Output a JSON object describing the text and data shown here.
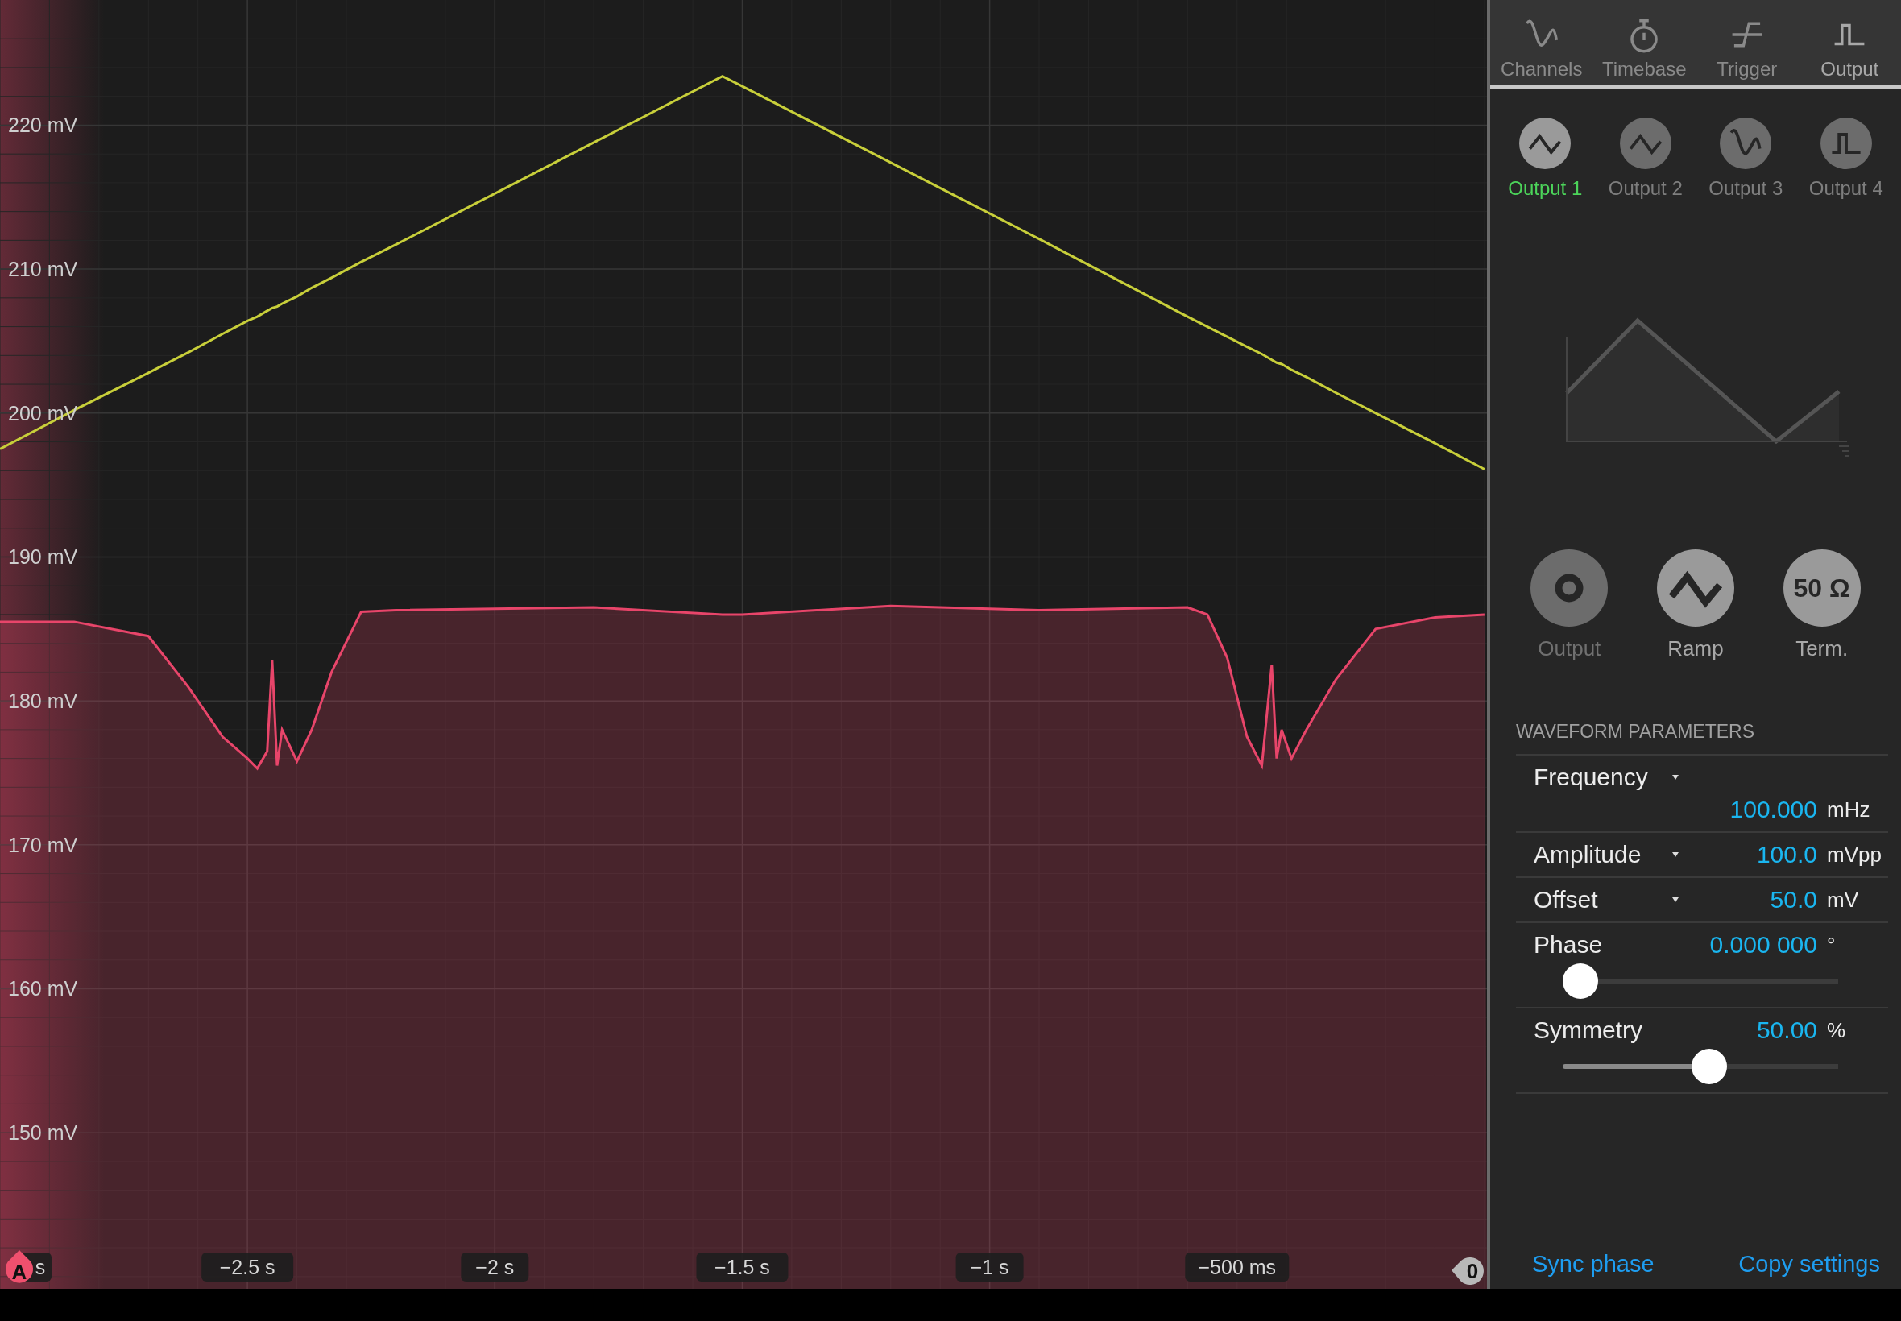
{
  "scope": {
    "chart_data": {
      "type": "line",
      "grid": true,
      "xlim": [
        -3.0,
        0.005
      ],
      "ylim": [
        139.15,
        228.7
      ],
      "yticks": [
        {
          "value": 220,
          "label": "220 mV"
        },
        {
          "value": 210,
          "label": "210 mV"
        },
        {
          "value": 200,
          "label": "200 mV"
        },
        {
          "value": 190,
          "label": "190 mV"
        },
        {
          "value": 180,
          "label": "180 mV"
        },
        {
          "value": 170,
          "label": "170 mV"
        },
        {
          "value": 160,
          "label": "160 mV"
        },
        {
          "value": 150,
          "label": "150 mV"
        }
      ],
      "xticks": [
        {
          "value": -2.5,
          "label": "−2.5 s"
        },
        {
          "value": -2.0,
          "label": "−2 s"
        },
        {
          "value": -1.5,
          "label": "−1.5 s"
        },
        {
          "value": -1.0,
          "label": "−1 s"
        }
      ],
      "x": [
        -3.0,
        -2.85,
        -2.7,
        -2.62,
        -2.55,
        -2.5,
        -2.48,
        -2.46,
        -2.45,
        -2.44,
        -2.43,
        -2.4,
        -2.37,
        -2.33,
        -2.27,
        -2.2,
        -1.8,
        -1.54,
        -1.5,
        -1.2,
        -0.9,
        -0.6,
        -0.56,
        -0.52,
        -0.48,
        -0.45,
        -0.43,
        -0.42,
        -0.41,
        -0.39,
        -0.36,
        -0.3,
        -0.22,
        -0.1,
        0.0
      ],
      "series": [
        {
          "color": "#c8cf3a",
          "values": [
            197.5,
            200.2,
            202.8,
            204.2,
            205.5,
            206.4,
            206.7,
            207.1,
            207.3,
            207.4,
            207.6,
            208.1,
            208.7,
            209.4,
            210.5,
            211.7,
            218.8,
            223.4,
            222.7,
            217.4,
            212.1,
            206.7,
            206.0,
            205.3,
            204.6,
            204.1,
            203.7,
            203.5,
            203.4,
            203.0,
            202.5,
            201.4,
            200.0,
            197.9,
            196.1
          ]
        },
        {
          "color": "#e8456a",
          "values": [
            185.5,
            185.5,
            184.5,
            181.0,
            177.5,
            176.0,
            175.3,
            176.5,
            182.8,
            175.5,
            178.0,
            175.8,
            178.0,
            182.0,
            186.2,
            186.3,
            186.5,
            186.0,
            186.0,
            186.6,
            186.3,
            186.5,
            186.0,
            183.0,
            177.5,
            175.5,
            182.5,
            176.0,
            178.0,
            176.0,
            178.0,
            181.5,
            185.0,
            185.8,
            186.0
          ]
        }
      ]
    },
    "left_time_label": "s",
    "ms_time_label": "−500 ms",
    "channel_marker": {
      "label": "A"
    },
    "zero_marker": {
      "label": "0"
    }
  },
  "tabs": [
    {
      "label": "Channels",
      "kind": "sine",
      "selected": false
    },
    {
      "label": "Timebase",
      "kind": "stopwatch",
      "selected": false
    },
    {
      "label": "Trigger",
      "kind": "trigger",
      "selected": false
    },
    {
      "label": "Output",
      "kind": "pulse",
      "selected": true
    }
  ],
  "outputs": [
    {
      "label": "Output 1",
      "kind": "triangle",
      "selected": true
    },
    {
      "label": "Output 2",
      "kind": "triangle",
      "selected": false
    },
    {
      "label": "Output 3",
      "kind": "sine",
      "selected": false
    },
    {
      "label": "Output 4",
      "kind": "pulse",
      "selected": false
    }
  ],
  "controls": [
    {
      "label": "Output",
      "kind": "power",
      "on": false
    },
    {
      "label": "Ramp",
      "kind": "triangle",
      "on": true
    },
    {
      "label": "Term.",
      "kind": "text",
      "symbol": "50 Ω",
      "on": true
    }
  ],
  "parameters": {
    "title": "WAVEFORM PARAMETERS",
    "rows": [
      {
        "kind": "dropdown-wrapped",
        "label": "Frequency",
        "value": "100.000",
        "unit": "mHz"
      },
      {
        "kind": "dropdown",
        "label": "Amplitude",
        "value": "100.0",
        "unit": "mVpp"
      },
      {
        "kind": "dropdown",
        "label": "Offset",
        "value": "50.0",
        "unit": "mV"
      },
      {
        "kind": "slider",
        "label": "Phase",
        "value": "0.000 000",
        "unit": "°",
        "level": 0
      },
      {
        "kind": "slider",
        "label": "Symmetry",
        "value": "50.00",
        "unit": "%",
        "level": 0.5
      }
    ]
  },
  "footer": {
    "links": [
      "Sync phase",
      "Copy settings"
    ]
  }
}
